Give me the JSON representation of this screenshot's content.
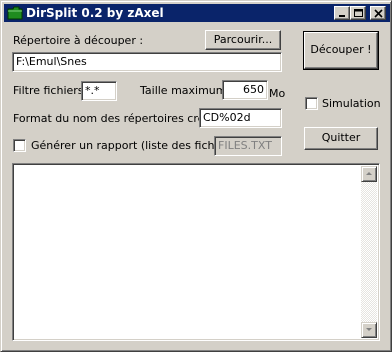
{
  "window": {
    "title": "DirSplit 0.2 by zAxel",
    "icon": "folder-icon",
    "controls": [
      "minimize-icon",
      "maximize-icon",
      "close-icon"
    ]
  },
  "form": {
    "source_label": "Répertoire à découper :",
    "source_value": "F:\\Emul\\Snes",
    "browse_button": "Parcourir...",
    "filter_label": "Filtre fichiers :",
    "filter_value": "*.*",
    "max_size_label": "Taille maximum :",
    "max_size_value": "650",
    "max_size_unit": "Mo",
    "dirname_format_label": "Format du nom des répertoires créés :",
    "dirname_format_value": "CD%02d",
    "report_checkbox_label": "Générer un rapport (liste des fichiers)",
    "report_checked": false,
    "report_filename": "FILES.TXT"
  },
  "actions": {
    "split_button": "Découper !",
    "simulation_label": "Simulation",
    "simulation_checked": false,
    "quit_button": "Quitter"
  },
  "log": {
    "text": ""
  },
  "colors": {
    "titlebar": "#0a246a",
    "face": "#d4d0c8"
  }
}
